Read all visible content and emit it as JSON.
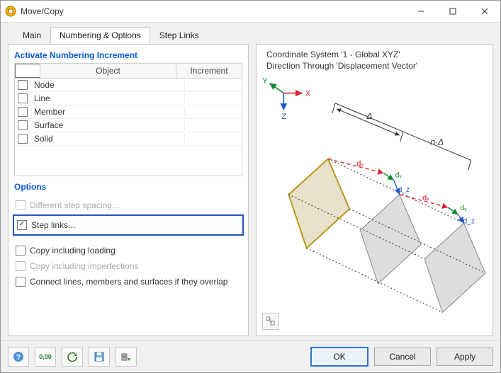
{
  "window": {
    "title": "Move/Copy"
  },
  "tabs": {
    "main": "Main",
    "numopts": "Numbering & Options",
    "steplinks": "Step Links",
    "active": "numopts"
  },
  "left": {
    "section_numbering": "Activate Numbering Increment",
    "headers": {
      "object": "Object",
      "increment": "Increment"
    },
    "rows": [
      {
        "label": "Node",
        "checked": false
      },
      {
        "label": "Line",
        "checked": false
      },
      {
        "label": "Member",
        "checked": false
      },
      {
        "label": "Surface",
        "checked": false
      },
      {
        "label": "Solid",
        "checked": false
      }
    ],
    "section_options": "Options",
    "options": {
      "diff_step": {
        "label": "Different step spacing...",
        "checked": false,
        "enabled": false
      },
      "step_links": {
        "label": "Step links...",
        "checked": true,
        "enabled": true
      },
      "copy_loading": {
        "label": "Copy including loading",
        "checked": false,
        "enabled": true
      },
      "copy_imperf": {
        "label": "Copy including imperfections",
        "checked": false,
        "enabled": false
      },
      "connect": {
        "label": "Connect lines, members and surfaces if they overlap",
        "checked": false,
        "enabled": true
      }
    }
  },
  "right": {
    "line1": "Coordinate System '1 - Global XYZ'",
    "line2": "Direction Through 'Displacement Vector'",
    "axes": {
      "x": "X",
      "y": "Y",
      "z": "Z"
    },
    "labels": {
      "delta": "Δ",
      "ndelta": "n·Δ",
      "dx": "dₓ",
      "dy": "dᵧ",
      "dz": "d_z"
    }
  },
  "footer": {
    "ok": "OK",
    "cancel": "Cancel",
    "apply": "Apply"
  },
  "icons": {
    "help": "?",
    "decimals": "0,00"
  }
}
